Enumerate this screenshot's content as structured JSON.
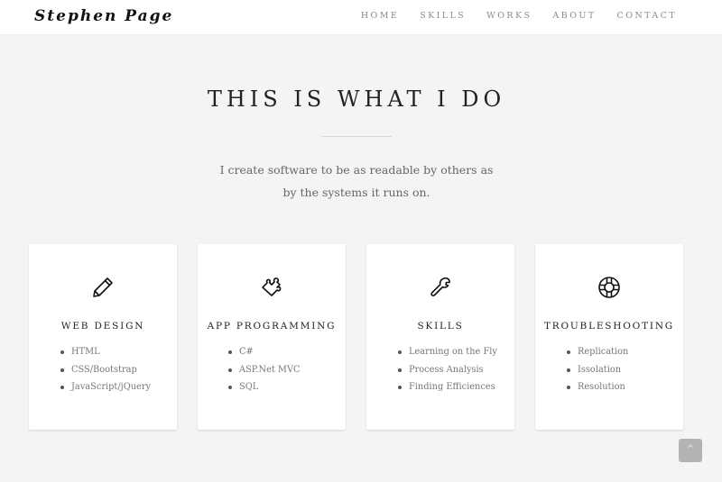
{
  "brand": "Stephen Page",
  "nav": [
    {
      "label": "HOME"
    },
    {
      "label": "SKILLS"
    },
    {
      "label": "WORKS"
    },
    {
      "label": "ABOUT"
    },
    {
      "label": "CONTACT"
    }
  ],
  "section": {
    "heading": "THIS IS WHAT I DO",
    "intro_line1": "I create software to be as readable by others as",
    "intro_line2": "by the systems it runs on."
  },
  "cards": [
    {
      "icon": "pencil-icon",
      "title": "WEB DESIGN",
      "items": [
        "HTML",
        "CSS/Bootstrap",
        "JavaScript/jQuery"
      ]
    },
    {
      "icon": "puzzle-piece-icon",
      "title": "APP PROGRAMMING",
      "items": [
        "C#",
        "ASP.Net MVC",
        "SQL"
      ]
    },
    {
      "icon": "wrench-icon",
      "title": "SKILLS",
      "items": [
        "Learning on the Fly",
        "Process Analysis",
        "Finding Efficiences"
      ]
    },
    {
      "icon": "life-ring-icon",
      "title": "TROUBLESHOOTING",
      "items": [
        "Replication",
        "Issolation",
        "Resolution"
      ]
    }
  ],
  "scroll_top": {
    "icon": "chevron-up-icon",
    "glyph": "^"
  }
}
